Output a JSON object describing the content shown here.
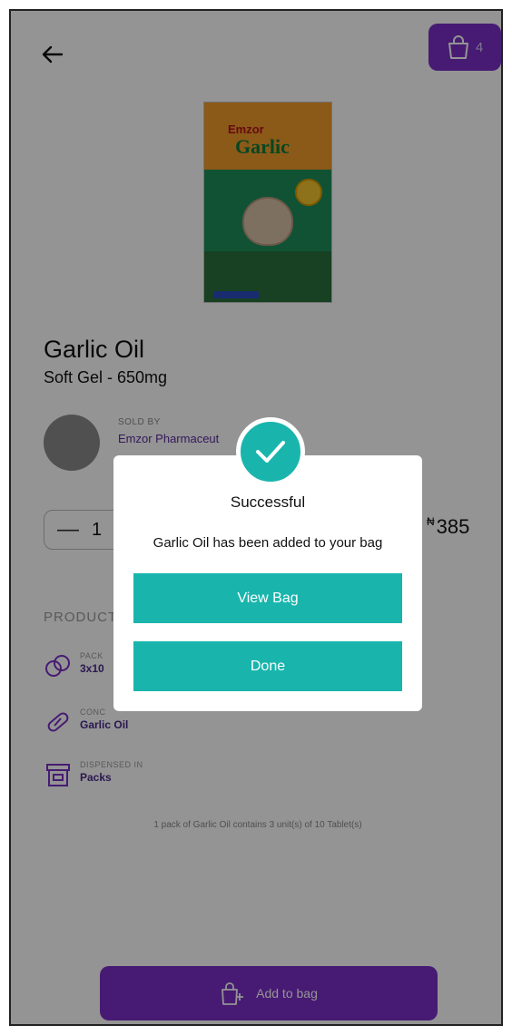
{
  "header": {
    "bag_count": "4"
  },
  "product_image": {
    "brand": "Emzor",
    "name": "Garlic"
  },
  "product": {
    "title": "Garlic Oil",
    "subtitle": "Soft Gel - 650mg"
  },
  "seller": {
    "label": "SOLD BY",
    "name": "Emzor Pharmaceut"
  },
  "quantity": {
    "minus": "—",
    "value": "1"
  },
  "price": {
    "currency": "₦",
    "amount": "385"
  },
  "details": {
    "section_title": "PRODUCT",
    "items": [
      {
        "label": "PACK",
        "value": "3x10",
        "icon": "pills-icon"
      },
      {
        "label": "CONC",
        "value": "Garlic Oil",
        "icon": "capsule-icon"
      },
      {
        "label": "DISPENSED IN",
        "value": "Packs",
        "icon": "pack-icon"
      }
    ],
    "note": "1 pack of Garlic Oil contains 3 unit(s) of 10 Tablet(s)"
  },
  "footer": {
    "add_label": "Add to bag"
  },
  "modal": {
    "title": "Successful",
    "message": "Garlic Oil has been added to your bag",
    "view_bag_label": "View Bag",
    "done_label": "Done"
  },
  "colors": {
    "primary_purple": "#7b2fc7",
    "teal": "#19b5ad"
  }
}
